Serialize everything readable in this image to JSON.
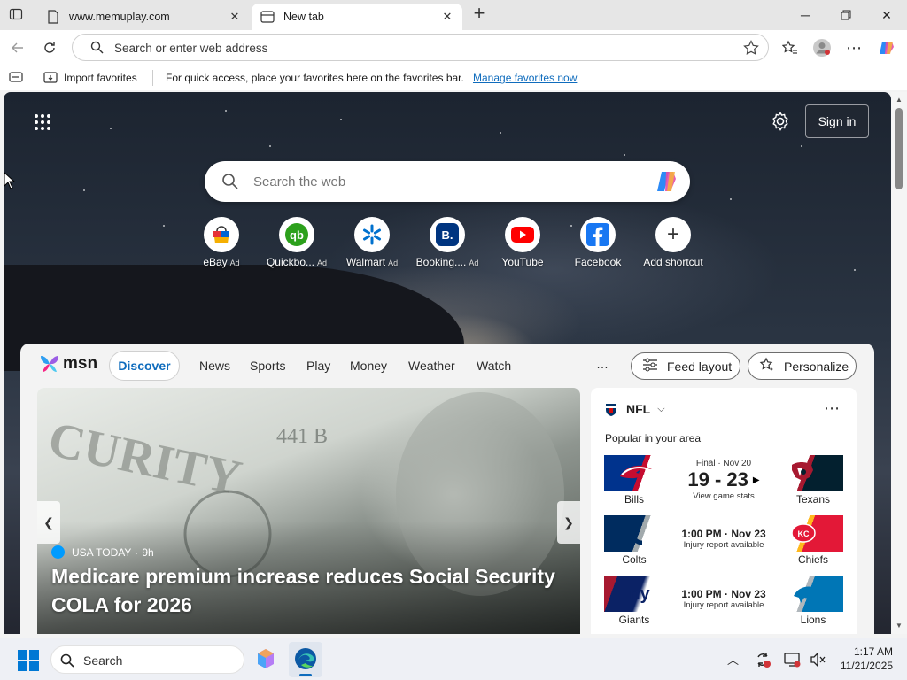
{
  "browser": {
    "tabs": [
      {
        "title": "www.memuplay.com",
        "active": false
      },
      {
        "title": "New tab",
        "active": true
      }
    ],
    "address_placeholder": "Search or enter web address",
    "favorites_bar": {
      "import_label": "Import favorites",
      "message": "For quick access, place your favorites here on the favorites bar.",
      "manage_link": "Manage favorites now"
    }
  },
  "newtab": {
    "sign_in": "Sign in",
    "search_placeholder": "Search the web",
    "shortcuts": [
      {
        "label": "eBay",
        "ad": "Ad",
        "icon": "ebay-icon"
      },
      {
        "label": "Quickbo...",
        "ad": "Ad",
        "icon": "quickbooks-icon"
      },
      {
        "label": "Walmart",
        "ad": "Ad",
        "icon": "walmart-icon"
      },
      {
        "label": "Booking....",
        "ad": "Ad",
        "icon": "booking-icon"
      },
      {
        "label": "YouTube",
        "ad": "",
        "icon": "youtube-icon"
      },
      {
        "label": "Facebook",
        "ad": "",
        "icon": "facebook-icon"
      },
      {
        "label": "Add shortcut",
        "ad": "",
        "icon": "plus-icon"
      }
    ]
  },
  "feed": {
    "brand": "msn",
    "tabs": [
      "Discover",
      "News",
      "Sports",
      "Play",
      "Money",
      "Weather",
      "Watch"
    ],
    "active_tab": "Discover",
    "more": "…",
    "feed_layout": "Feed layout",
    "personalize": "Personalize",
    "hero": {
      "source": "USA TODAY",
      "age": "9h",
      "headline": "Medicare premium increase reduces Social Security COLA for 2026"
    },
    "nfl": {
      "title": "NFL",
      "subtitle": "Popular in your area",
      "games": [
        {
          "home": "Bills",
          "away": "Texans",
          "status": "Final · Nov 20",
          "score": "19 - 23",
          "note": "View game stats",
          "home_color": "#00338d",
          "away_color": "#03202f"
        },
        {
          "home": "Colts",
          "away": "Chiefs",
          "status": "1:00 PM · Nov 23",
          "score": "",
          "note": "Injury report available",
          "home_color": "#002c5f",
          "away_color": "#e31837"
        },
        {
          "home": "Giants",
          "away": "Lions",
          "status": "1:00 PM · Nov 23",
          "score": "",
          "note": "Injury report available",
          "home_color": "#0b2265",
          "away_color": "#0076b6"
        }
      ]
    }
  },
  "taskbar": {
    "search_placeholder": "Search",
    "time": "1:17 AM",
    "date": "11/21/2025"
  },
  "colors": {
    "edge_accent": "#0f6cbd",
    "msn_blue": "#0f6cbd"
  }
}
